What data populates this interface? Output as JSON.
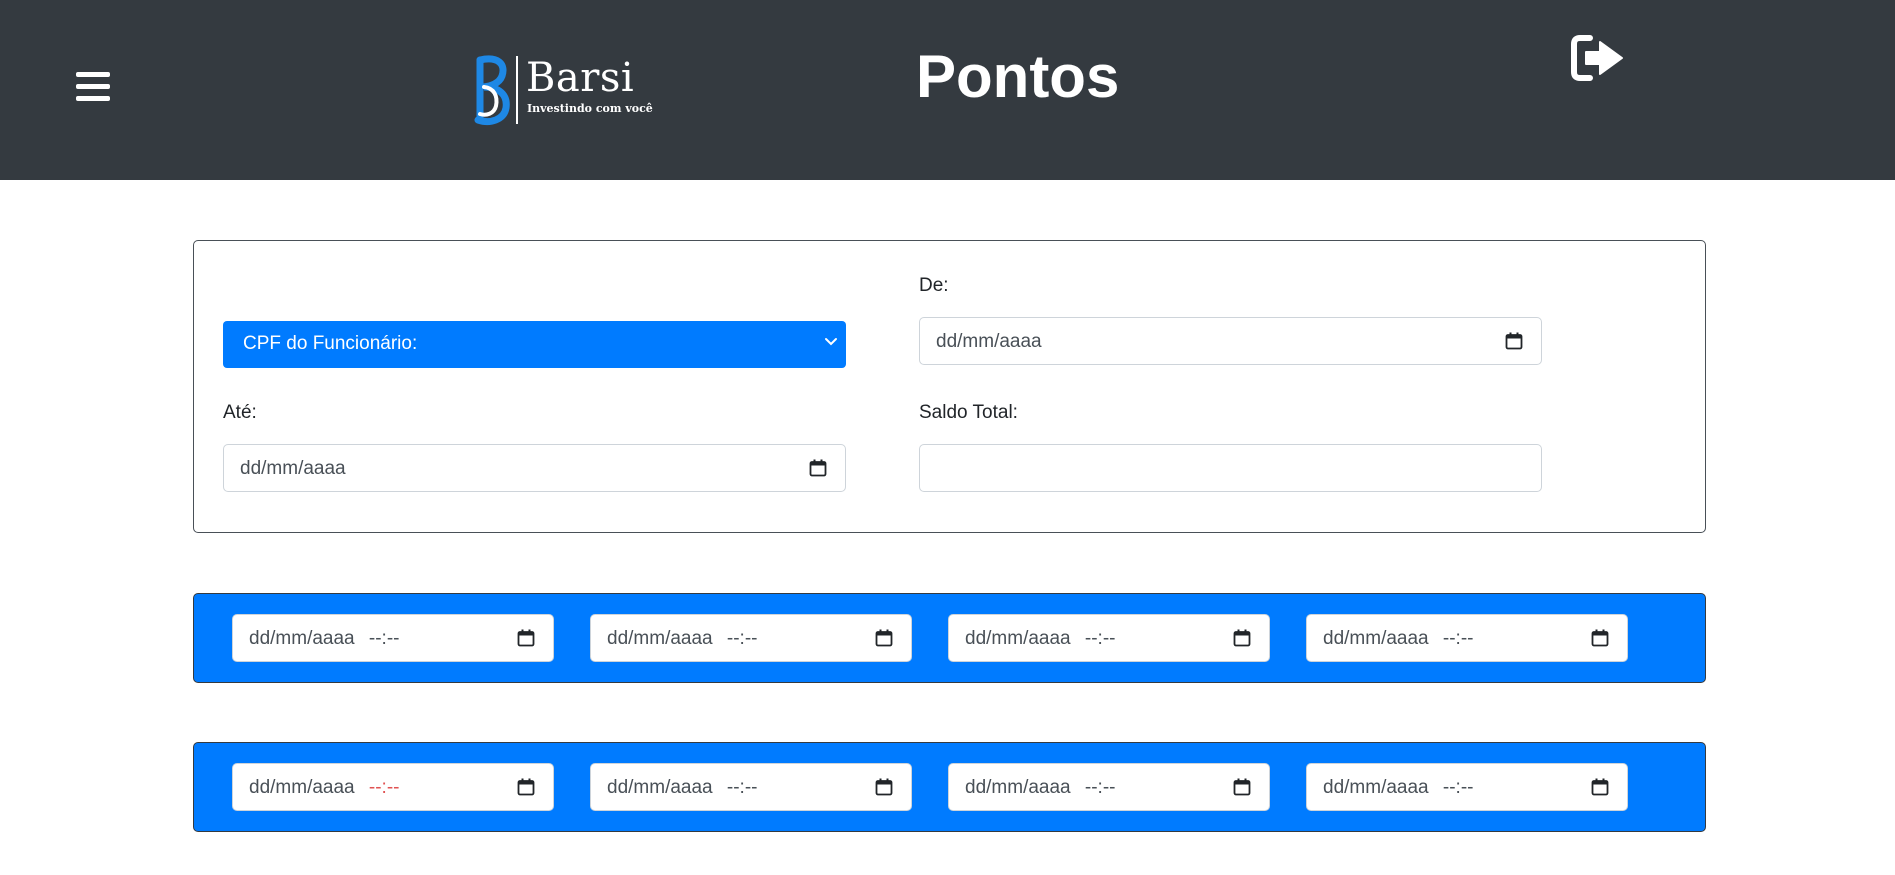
{
  "header": {
    "brand_name": "Barsi",
    "brand_tagline": "Investindo com você",
    "title": "Pontos",
    "menu_icon": "hamburger-menu-icon",
    "logout_icon": "sign-out-icon"
  },
  "filters": {
    "cpf_select": {
      "selected": "CPF do Funcionário:"
    },
    "de": {
      "label": "De:",
      "placeholder": "dd/mm/aaaa"
    },
    "ate": {
      "label": "Até:",
      "placeholder": "dd/mm/aaaa"
    },
    "saldo_total": {
      "label": "Saldo Total:",
      "value": ""
    }
  },
  "ponto_rows": [
    {
      "fields": [
        {
          "date": "dd/mm/aaaa",
          "time": "--:--"
        },
        {
          "date": "dd/mm/aaaa",
          "time": "--:--"
        },
        {
          "date": "dd/mm/aaaa",
          "time": "--:--"
        },
        {
          "date": "dd/mm/aaaa",
          "time": "--:--"
        }
      ]
    },
    {
      "fields": [
        {
          "date": "dd/mm/aaaa",
          "time": "--:--"
        },
        {
          "date": "dd/mm/aaaa",
          "time": "--:--"
        },
        {
          "date": "dd/mm/aaaa",
          "time": "--:--"
        },
        {
          "date": "dd/mm/aaaa",
          "time": "--:--"
        }
      ]
    }
  ],
  "colors": {
    "header_bg": "#343a40",
    "primary": "#007bff",
    "logo_blue": "#1e88e5"
  }
}
